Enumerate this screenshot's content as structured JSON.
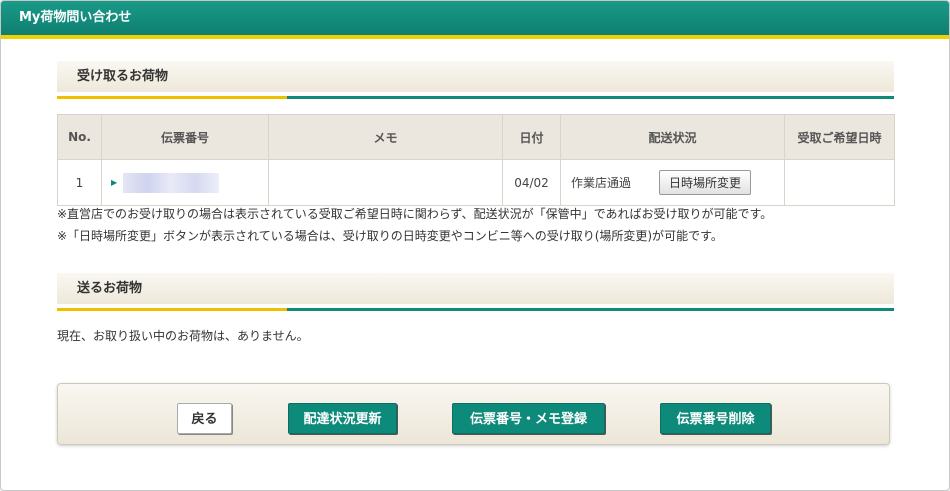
{
  "window": {
    "title": "My荷物問い合わせ"
  },
  "receive": {
    "heading": "受け取るお荷物",
    "columns": [
      "No.",
      "伝票番号",
      "メモ",
      "日付",
      "配送状況",
      "受取ご希望日時"
    ],
    "rows": [
      {
        "no": "1",
        "tracking": "",
        "memo": "",
        "date": "04/02",
        "status": "作業店通過",
        "action_label": "日時場所変更",
        "desired": ""
      }
    ],
    "notes": [
      "※直営店でのお受け取りの場合は表示されている受取ご希望日時に関わらず、配送状況が「保管中」であればお受け取りが可能です。",
      "※「日時場所変更」ボタンが表示されている場合は、受け取りの日時変更やコンビニ等への受け取り(場所変更)が可能です。"
    ]
  },
  "send": {
    "heading": "送るお荷物",
    "empty_message": "現在、お取り扱い中のお荷物は、ありません。"
  },
  "actions": {
    "back": "戻る",
    "refresh": "配達状況更新",
    "register": "伝票番号・メモ登録",
    "delete": "伝票番号削除"
  },
  "colors": {
    "brand_green": "#0e8a7a",
    "accent_yellow": "#f0c000"
  }
}
